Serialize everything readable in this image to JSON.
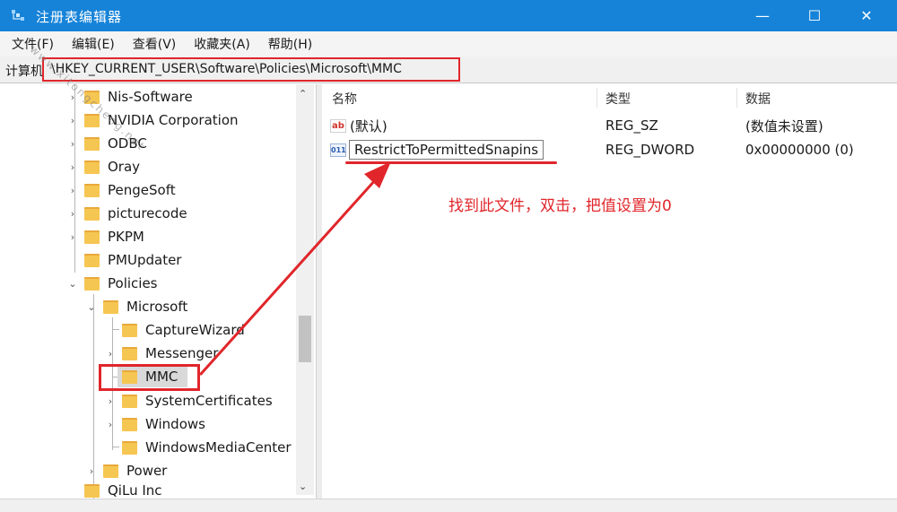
{
  "window": {
    "title": "注册表编辑器",
    "controls": {
      "minimize": "—",
      "maximize": "☐",
      "close": "✕"
    }
  },
  "menu": [
    "文件(F)",
    "编辑(E)",
    "查看(V)",
    "收藏夹(A)",
    "帮助(H)"
  ],
  "address": {
    "label": "计算机",
    "path": "\\HKEY_CURRENT_USER\\Software\\Policies\\Microsoft\\MMC"
  },
  "tree": {
    "items": [
      {
        "label": "Nis-Software",
        "expander": "›"
      },
      {
        "label": "NVIDIA Corporation",
        "expander": "›"
      },
      {
        "label": "ODBC",
        "expander": "›"
      },
      {
        "label": "Oray",
        "expander": "›"
      },
      {
        "label": "PengeSoft",
        "expander": "›"
      },
      {
        "label": "picturecode",
        "expander": "›"
      },
      {
        "label": "PKPM",
        "expander": "›"
      },
      {
        "label": "PMUpdater",
        "expander": ""
      },
      {
        "label": "Policies",
        "expander": "⌄"
      },
      {
        "label": "Microsoft",
        "expander": "⌄"
      },
      {
        "label": "CaptureWizard",
        "expander": ""
      },
      {
        "label": "Messenger",
        "expander": "›"
      },
      {
        "label": "MMC",
        "expander": ""
      },
      {
        "label": "SystemCertificates",
        "expander": "›"
      },
      {
        "label": "Windows",
        "expander": "›"
      },
      {
        "label": "WindowsMediaCenter",
        "expander": ""
      },
      {
        "label": "Power",
        "expander": "›"
      },
      {
        "label": "QiLu Inc",
        "expander": "›"
      }
    ],
    "scroll_up": "⌃",
    "scroll_down": "⌄"
  },
  "values": {
    "columns": {
      "name": "名称",
      "type": "类型",
      "data": "数据"
    },
    "rows": [
      {
        "icon": "ab",
        "name": "(默认)",
        "type": "REG_SZ",
        "data": "(数值未设置)"
      },
      {
        "icon": "011",
        "name": "RestrictToPermittedSnapins",
        "type": "REG_DWORD",
        "data": "0x00000000 (0)"
      }
    ]
  },
  "annotation": "找到此文件，双击，把值设置为0",
  "watermark": "www.xitongcheng.net",
  "colors": {
    "titlebar": "#1683d8",
    "highlight_red": "#e0262b",
    "folder": "#f6c652"
  }
}
